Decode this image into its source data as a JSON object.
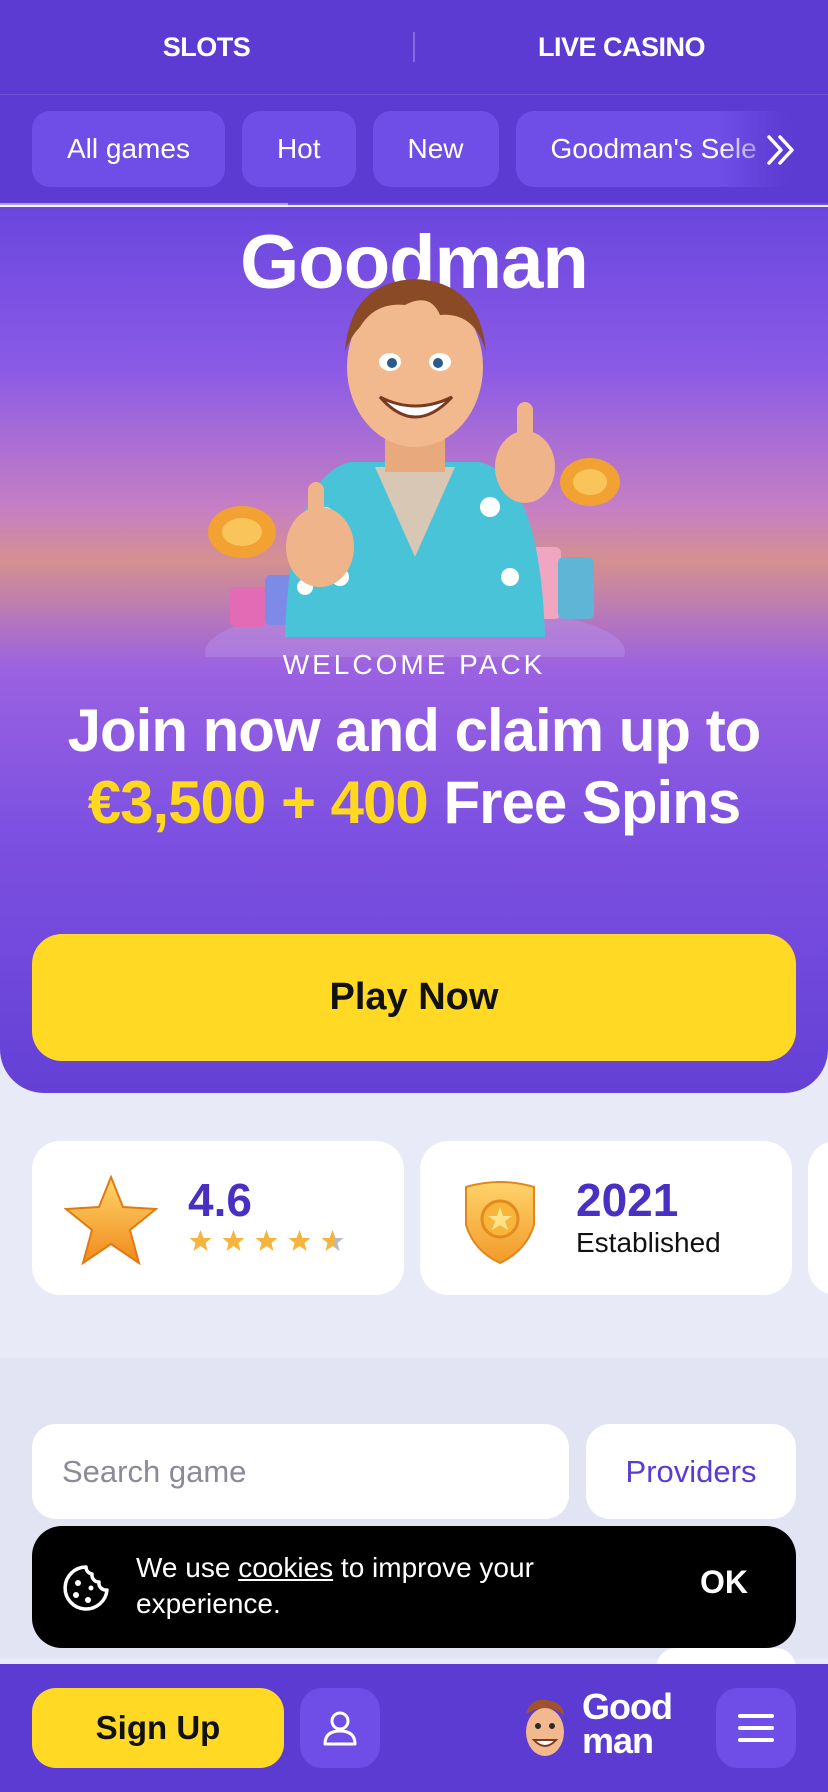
{
  "topnav": {
    "tabs": [
      "SLOTS",
      "LIVE CASINO"
    ]
  },
  "filters": {
    "chips": [
      "All games",
      "Hot",
      "New",
      "Goodman's Sele"
    ],
    "more_icon": "double-chevron-right-icon"
  },
  "hero": {
    "logo": "Goodman",
    "eyebrow": "WELCOME PACK",
    "headline_start": "Join now and claim up to",
    "headline_amount": "€3,500 + 400",
    "headline_end": "Free Spins",
    "cta": "Play Now"
  },
  "stats": [
    {
      "value": "4.6",
      "icon": "star-icon",
      "rating": 4.6
    },
    {
      "value": "2021",
      "label": "Established",
      "icon": "badge-icon"
    }
  ],
  "search": {
    "placeholder": "Search game"
  },
  "providers": {
    "label": "Providers"
  },
  "cookie_banner": {
    "text_before": "We use",
    "link": "cookies",
    "text_after": "to improve your experience.",
    "ok": "OK",
    "icon": "cookie-icon"
  },
  "bottom_bar": {
    "signup": "Sign Up",
    "brand_line1": "Good",
    "brand_line2": "man",
    "user_icon": "user-icon",
    "menu_icon": "hamburger-menu-icon"
  },
  "colors": {
    "primary": "#5b3bd1",
    "accent": "#ffd923",
    "chip": "#6e4ee7",
    "stat_text": "#4a2fc2"
  }
}
